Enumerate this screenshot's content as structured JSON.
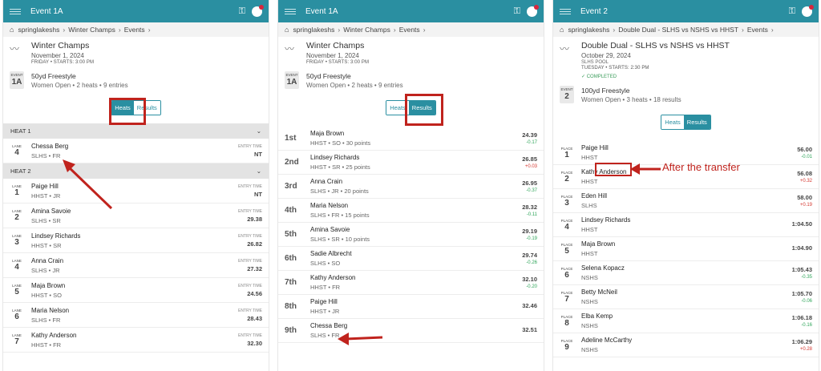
{
  "icons": {
    "menu": "menu-icon",
    "home": "home-icon",
    "key": "key-icon",
    "bell": "bell-icon",
    "chevron": "chevron-down-icon",
    "logo": "swim-logo-icon"
  },
  "accent": "#2a8fa1",
  "highlight": "#c0231d",
  "panel1": {
    "title": "Event 1A",
    "crumbs": [
      "springlakeshs",
      "Winter Champs",
      "Events"
    ],
    "meet": {
      "name": "Winter Champs",
      "date": "November 1, 2024",
      "day": "FRIDAY • STARTS: 3:00 PM"
    },
    "event": {
      "label": "EVENT",
      "num": "1A",
      "name": "50yd Freestyle",
      "desc": "Women Open • 2 heats • 9 entries"
    },
    "toggle": {
      "heats": "Heats",
      "results": "Results"
    },
    "heats": [
      {
        "label": "HEAT 1",
        "rows": [
          {
            "lane": "4",
            "name": "Chessa Berg",
            "sub": "SLHS • FR",
            "time": "NT"
          }
        ]
      },
      {
        "label": "HEAT 2",
        "rows": [
          {
            "lane": "1",
            "name": "Paige Hill",
            "sub": "HHST • JR",
            "time": "NT"
          },
          {
            "lane": "2",
            "name": "Amina Savoie",
            "sub": "SLHS • SR",
            "time": "29.38"
          },
          {
            "lane": "3",
            "name": "Lindsey Richards",
            "sub": "HHST • SR",
            "time": "26.82"
          },
          {
            "lane": "4",
            "name": "Anna Crain",
            "sub": "SLHS • JR",
            "time": "27.32"
          },
          {
            "lane": "5",
            "name": "Maja Brown",
            "sub": "HHST • SO",
            "time": "24.56"
          },
          {
            "lane": "6",
            "name": "Maria Nelson",
            "sub": "SLHS • FR",
            "time": "28.43"
          },
          {
            "lane": "7",
            "name": "Kathy Anderson",
            "sub": "HHST • FR",
            "time": "32.30"
          }
        ]
      }
    ],
    "lane_label": "LANE",
    "entry_label": "ENTRY TIME"
  },
  "panel2": {
    "title": "Event 1A",
    "crumbs": [
      "springlakeshs",
      "Winter Champs",
      "Events"
    ],
    "meet": {
      "name": "Winter Champs",
      "date": "November 1, 2024",
      "day": "FRIDAY • STARTS: 3:00 PM"
    },
    "event": {
      "label": "EVENT",
      "num": "1A",
      "name": "50yd Freestyle",
      "desc": "Women Open • 2 heats • 9 entries"
    },
    "toggle": {
      "heats": "Heats",
      "results": "Results"
    },
    "results": [
      {
        "place": "1st",
        "name": "Maja Brown",
        "sub": "HHST • SO • 30 points",
        "time": "24.39",
        "diff": "-0.17",
        "dir": "pos"
      },
      {
        "place": "2nd",
        "name": "Lindsey Richards",
        "sub": "HHST • SR • 25 points",
        "time": "26.85",
        "diff": "+0.03",
        "dir": "neg"
      },
      {
        "place": "3rd",
        "name": "Anna Crain",
        "sub": "SLHS • JR • 20 points",
        "time": "26.95",
        "diff": "-0.37",
        "dir": "pos"
      },
      {
        "place": "4th",
        "name": "Maria Nelson",
        "sub": "SLHS • FR • 15 points",
        "time": "28.32",
        "diff": "-0.11",
        "dir": "pos"
      },
      {
        "place": "5th",
        "name": "Amina Savoie",
        "sub": "SLHS • SR • 10 points",
        "time": "29.19",
        "diff": "-0.19",
        "dir": "pos"
      },
      {
        "place": "6th",
        "name": "Sadie Albrecht",
        "sub": "SLHS • SO",
        "time": "29.74",
        "diff": "-0.26",
        "dir": "pos"
      },
      {
        "place": "7th",
        "name": "Kathy Anderson",
        "sub": "HHST • FR",
        "time": "32.10",
        "diff": "-0.20",
        "dir": "pos"
      },
      {
        "place": "8th",
        "name": "Paige Hill",
        "sub": "HHST • JR",
        "time": "32.46",
        "diff": "",
        "dir": ""
      },
      {
        "place": "9th",
        "name": "Chessa Berg",
        "sub": "SLHS • FR",
        "time": "32.51",
        "diff": "",
        "dir": ""
      }
    ]
  },
  "panel3": {
    "title": "Event 2",
    "crumbs": [
      "springlakeshs",
      "Double Dual - SLHS vs NSHS vs HHST",
      "Events"
    ],
    "meet": {
      "name": "Double Dual - SLHS vs NSHS vs HHST",
      "date": "October 29, 2024",
      "pool": "SLHS POOL",
      "day": "TUESDAY • STARTS: 2:30 PM",
      "status": "✓ COMPLETED"
    },
    "event": {
      "label": "EVENT",
      "num": "2",
      "name": "100yd Freestyle",
      "desc": "Women Open • 3 heats • 18 results"
    },
    "toggle": {
      "heats": "Heats",
      "results": "Results"
    },
    "place_label": "PLACE",
    "results": [
      {
        "place": "1",
        "name": "Paige Hill",
        "sub": "HHST",
        "time": "56.00",
        "diff": "-0.01",
        "dir": "pos"
      },
      {
        "place": "2",
        "name": "Kathy Anderson",
        "sub": "HHST",
        "time": "56.08",
        "diff": "+0.32",
        "dir": "neg"
      },
      {
        "place": "3",
        "name": "Eden Hill",
        "sub": "SLHS",
        "time": "58.00",
        "diff": "+0.19",
        "dir": "neg"
      },
      {
        "place": "4",
        "name": "Lindsey Richards",
        "sub": "HHST",
        "time": "1:04.50",
        "diff": "",
        "dir": ""
      },
      {
        "place": "5",
        "name": "Maja Brown",
        "sub": "HHST",
        "time": "1:04.90",
        "diff": "",
        "dir": ""
      },
      {
        "place": "6",
        "name": "Selena Kopacz",
        "sub": "NSHS",
        "time": "1:05.43",
        "diff": "-0.35",
        "dir": "pos"
      },
      {
        "place": "7",
        "name": "Betty McNeil",
        "sub": "NSHS",
        "time": "1:05.70",
        "diff": "-0.06",
        "dir": "pos"
      },
      {
        "place": "8",
        "name": "Elba Kemp",
        "sub": "NSHS",
        "time": "1:06.18",
        "diff": "-0.16",
        "dir": "pos"
      },
      {
        "place": "9",
        "name": "Adeline McCarthy",
        "sub": "NSHS",
        "time": "1:06.29",
        "diff": "+0.28",
        "dir": "neg"
      }
    ],
    "annotation": "After the transfer"
  }
}
